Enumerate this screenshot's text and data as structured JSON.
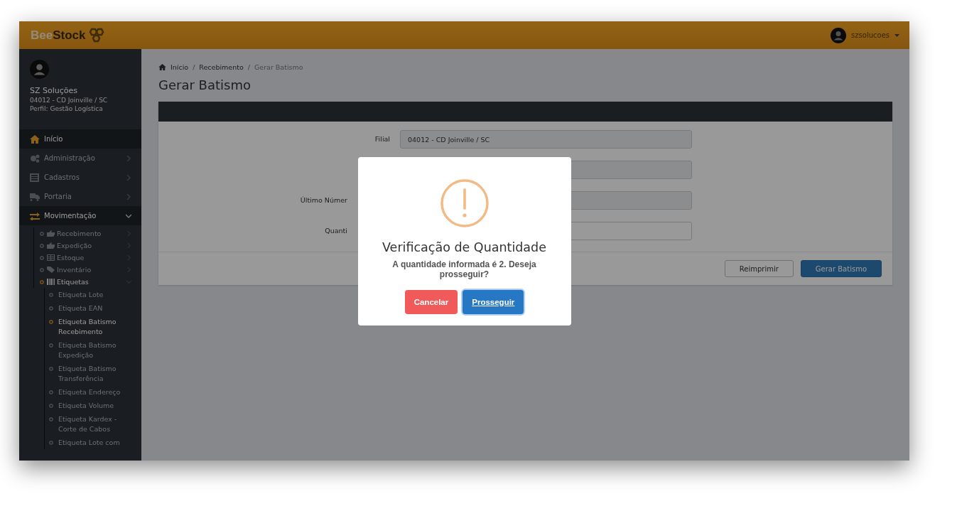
{
  "header": {
    "logo_part_1": "Bee",
    "logo_part_2": "Stock",
    "username": "szsolucoes"
  },
  "sidebar": {
    "company": "SZ Soluções",
    "branch": "04012 - CD Joinville / SC",
    "profile": "Perfil: Gestão Logística",
    "menu": [
      {
        "label": "Início",
        "kind": "link",
        "selected": true,
        "expanded": false
      },
      {
        "label": "Administração",
        "kind": "group",
        "selected": false,
        "expanded": false
      },
      {
        "label": "Cadastros",
        "kind": "group",
        "selected": false,
        "expanded": false
      },
      {
        "label": "Portaria",
        "kind": "group",
        "selected": false,
        "expanded": false
      },
      {
        "label": "Movimentação",
        "kind": "group",
        "selected": true,
        "expanded": true,
        "children": [
          {
            "label": "Recebimento",
            "kind": "group",
            "selected": false,
            "expanded": false
          },
          {
            "label": "Expedição",
            "kind": "group",
            "selected": false,
            "expanded": false
          },
          {
            "label": "Estoque",
            "kind": "group",
            "selected": false,
            "expanded": false
          },
          {
            "label": "Inventário",
            "kind": "group",
            "selected": false,
            "expanded": false
          },
          {
            "label": "Etiquetas",
            "kind": "group",
            "selected": true,
            "expanded": true,
            "children": [
              {
                "label": "Etiqueta Lote",
                "selected": false
              },
              {
                "label": "Etiqueta EAN",
                "selected": false
              },
              {
                "label": "Etiqueta Batismo Recebimento",
                "selected": true
              },
              {
                "label": "Etiqueta Batismo Expedição",
                "selected": false
              },
              {
                "label": "Etiqueta Batismo Transferência",
                "selected": false
              },
              {
                "label": "Etiqueta Endereço",
                "selected": false
              },
              {
                "label": "Etiqueta Volume",
                "selected": false
              },
              {
                "label": "Etiqueta Kardex - Corte de Cabos",
                "selected": false
              },
              {
                "label": "Etiqueta Lote com",
                "selected": false
              }
            ]
          }
        ]
      }
    ]
  },
  "breadcrumb": [
    {
      "label": "Início"
    },
    {
      "separator": "/",
      "label": "Recebimento"
    },
    {
      "separator": "/",
      "label": "Gerar Batismo"
    }
  ],
  "page_title": "Gerar Batismo",
  "form": {
    "fields": [
      {
        "label": "Filial",
        "value": "04012 - CD Joinville / SC",
        "readonly": true,
        "obscured": false
      },
      {
        "readonly": true,
        "obscured": true
      },
      {
        "label": "Último Númer",
        "readonly": true,
        "obscured": true
      },
      {
        "label": "Quanti",
        "readonly": false,
        "obscured": true
      }
    ],
    "buttons": [
      {
        "label": "Reimprimir",
        "kind": "default"
      },
      {
        "label": "Gerar Batismo",
        "kind": "primary"
      }
    ]
  },
  "modal": {
    "title": "Verificação de Quantidade",
    "message": "A quantidade informada é 2. Deseja prosseguir?",
    "buttons": [
      {
        "label": "Cancelar",
        "kind": "cancel",
        "focused": false
      },
      {
        "label": "Prosseguir",
        "kind": "confirm",
        "focused": true
      }
    ]
  }
}
